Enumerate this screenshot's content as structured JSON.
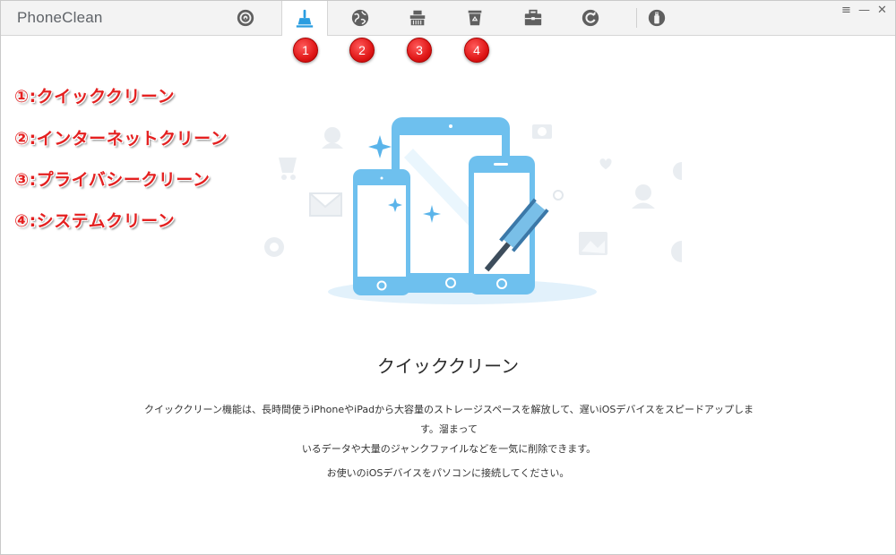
{
  "app": {
    "title": "PhoneClean"
  },
  "window_controls": {
    "menu": "≡",
    "minimize": "—",
    "close": "✕"
  },
  "tabs": [
    {
      "icon": "airdrop-icon",
      "active": false
    },
    {
      "icon": "broom-icon",
      "active": true
    },
    {
      "icon": "globe-icon",
      "active": false
    },
    {
      "icon": "eraser-icon",
      "active": false
    },
    {
      "icon": "recycle-bin-icon",
      "active": false
    },
    {
      "icon": "toolbox-icon",
      "active": false
    },
    {
      "icon": "restore-icon",
      "active": false
    },
    {
      "icon": "usb-icon",
      "active": false
    }
  ],
  "badges": [
    "1",
    "2",
    "3",
    "4"
  ],
  "legend": [
    "①:クイッククリーン",
    "②:インターネットクリーン",
    "③:プライバシークリーン",
    "④:システムクリーン"
  ],
  "main": {
    "heading": "クイッククリーン",
    "description_line1": "クイッククリーン機能は、長時間使うiPhoneやiPadから大容量のストレージスペースを解放して、遅いiOSデバイスをスピードアップします。溜まって",
    "description_line2": "いるデータや大量のジャンクファイルなどを一気に削除できます。",
    "hint": "お使いのiOSデバイスをパソコンに接続してください。"
  },
  "colors": {
    "accent": "#2a9de0",
    "device_blue": "#6ec0ee",
    "badge_red": "#e01818",
    "legend_red": "#e42020"
  }
}
